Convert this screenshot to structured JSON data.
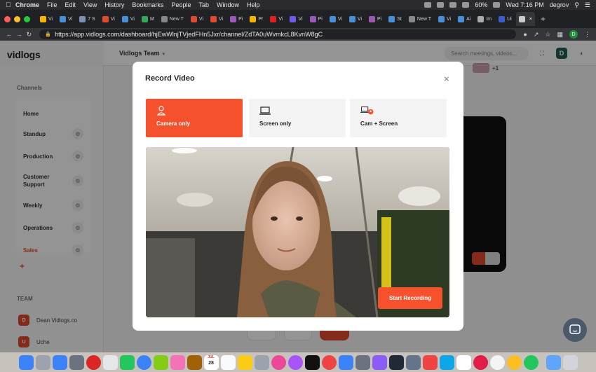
{
  "menubar": {
    "app": "Chrome",
    "items": [
      "File",
      "Edit",
      "View",
      "History",
      "Bookmarks",
      "People",
      "Tab",
      "Window",
      "Help"
    ],
    "battery": "60%",
    "clock": "Wed 7:16 PM",
    "user": "degrov"
  },
  "tabs": [
    {
      "label": "Vi",
      "color": "#f4b400"
    },
    {
      "label": "Vi",
      "color": "#4a90d9"
    },
    {
      "label": "7 S",
      "color": "#7b8fb5"
    },
    {
      "label": "Vi",
      "color": "#e04a2f"
    },
    {
      "label": "Vi",
      "color": "#4a90d9"
    },
    {
      "label": "M",
      "color": "#34a853"
    },
    {
      "label": "New T",
      "color": "#888888"
    },
    {
      "label": "Vi",
      "color": "#e04a2f"
    },
    {
      "label": "Vi",
      "color": "#e04a2f"
    },
    {
      "label": "Pi",
      "color": "#9b59b6"
    },
    {
      "label": "Pr",
      "color": "#f4b400"
    },
    {
      "label": "Vi",
      "color": "#e02020"
    },
    {
      "label": "Vi",
      "color": "#6e5ce6"
    },
    {
      "label": "Pi",
      "color": "#9b59b6"
    },
    {
      "label": "Vi",
      "color": "#4a90d9"
    },
    {
      "label": "Vi",
      "color": "#4a90d9"
    },
    {
      "label": "Pi",
      "color": "#9b59b6"
    },
    {
      "label": "St",
      "color": "#4a90d9"
    },
    {
      "label": "New T",
      "color": "#888888"
    },
    {
      "label": "Vi",
      "color": "#4a90d9"
    },
    {
      "label": "Ai",
      "color": "#4a90d9"
    },
    {
      "label": "Im",
      "color": "#aaaaaa"
    },
    {
      "label": "Ui",
      "color": "#3a5fcd"
    },
    {
      "label": "",
      "color": "#cccccc",
      "active": true
    }
  ],
  "address": {
    "url": "https://app.vidlogs.com/dashboard/hjEwWlnjTVjedFHn5Jxr/channel/ZdTA0uWvmkcL8KvnW8gC",
    "profile_initial": "D"
  },
  "app": {
    "logo": "vidlogs",
    "team_name": "Vidlogs Team",
    "search_placeholder": "Search meetings, videos...",
    "user_initial": "D"
  },
  "sidebar": {
    "channels_heading": "Channels",
    "channels": [
      {
        "name": "Home",
        "gear": false
      },
      {
        "name": "Standup",
        "gear": true
      },
      {
        "name": "Production",
        "gear": true
      },
      {
        "name": "Customer Support",
        "gear": true
      },
      {
        "name": "Weekly",
        "gear": true
      },
      {
        "name": "Operations",
        "gear": true
      },
      {
        "name": "Sales",
        "gear": true,
        "active": true
      }
    ],
    "add_symbol": "+",
    "team_heading": "TEAM",
    "members": [
      {
        "initial": "D",
        "name": "Dean Vidlogs.co"
      },
      {
        "initial": "U",
        "name": "Uche"
      }
    ]
  },
  "background": {
    "participants_extra": "+1"
  },
  "modal": {
    "title": "Record Video",
    "close_symbol": "×",
    "options": [
      {
        "label": "Camera only",
        "selected": true
      },
      {
        "label": "Screen only",
        "selected": false
      },
      {
        "label": "Cam + Screen",
        "selected": false
      }
    ],
    "start_button": "Start Recording"
  },
  "colors": {
    "accent": "#f4512c",
    "brand_red": "#e04a2f"
  },
  "dock": {
    "calendar_month": "JUL",
    "calendar_day": "28"
  }
}
